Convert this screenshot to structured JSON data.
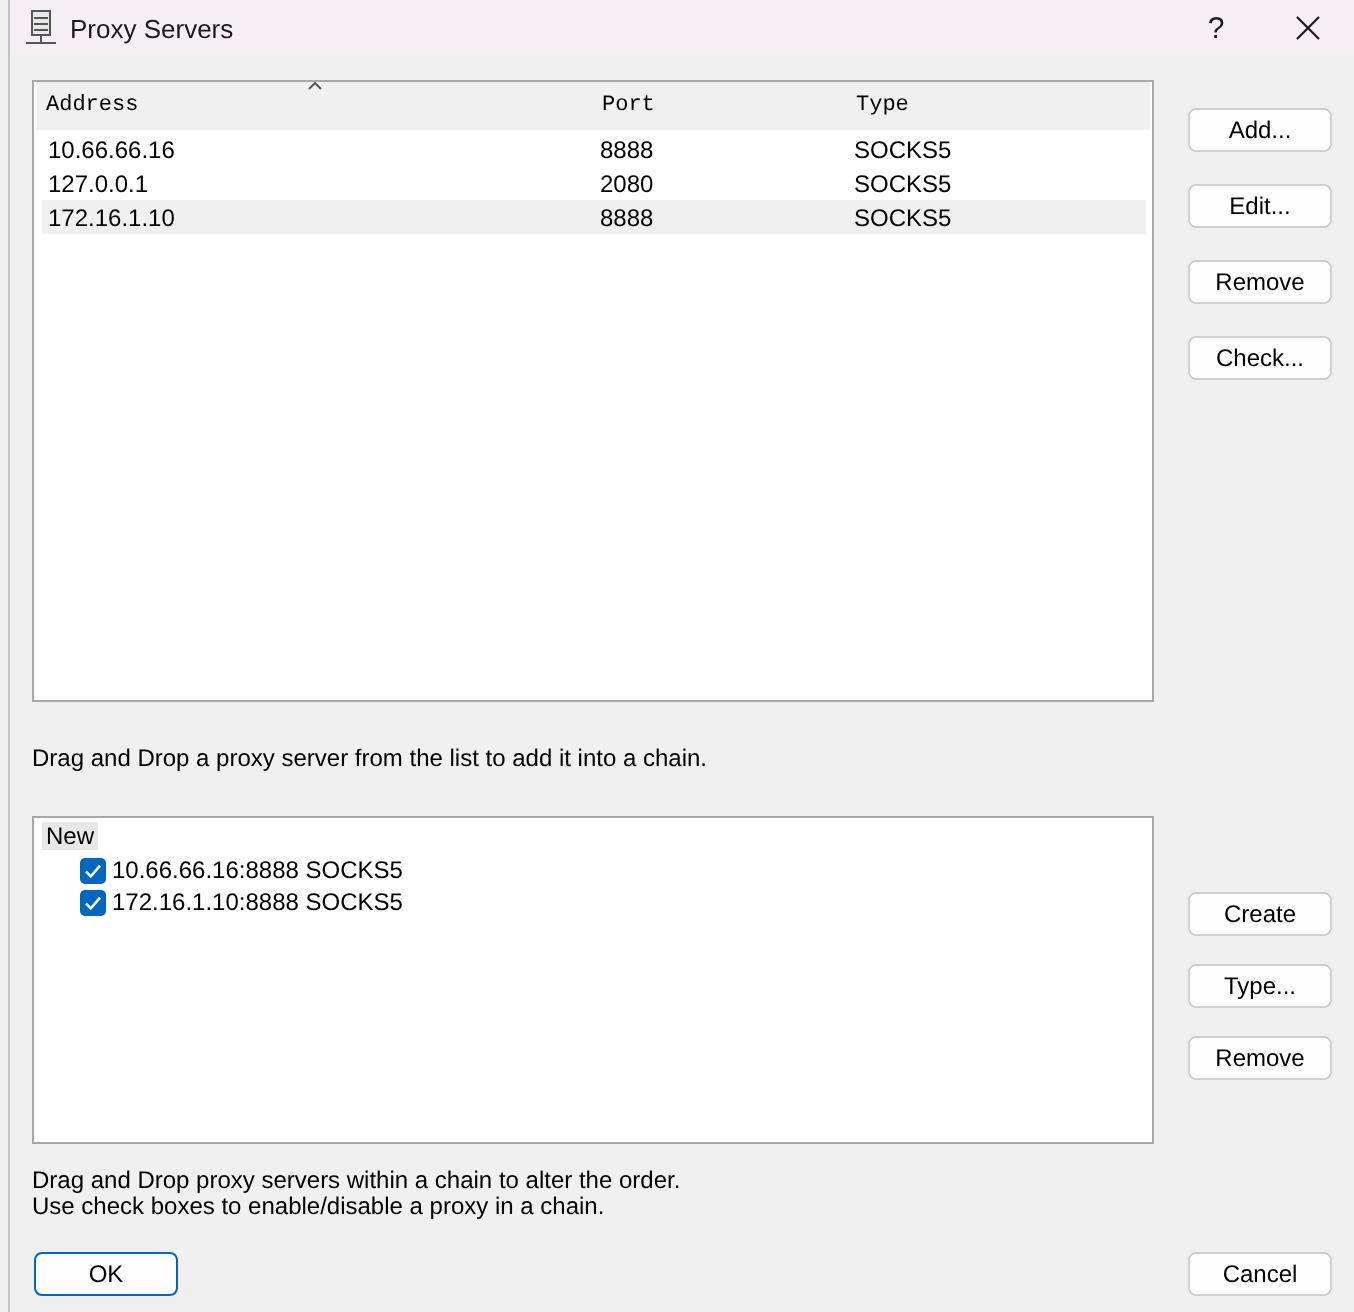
{
  "window": {
    "title": "Proxy Servers",
    "help": "?"
  },
  "proxy_table": {
    "columns": [
      {
        "label": "Address",
        "sorted": true
      },
      {
        "label": "Port",
        "sorted": false
      },
      {
        "label": "Type",
        "sorted": false
      }
    ],
    "rows": [
      {
        "address": "10.66.66.16",
        "port": "8888",
        "type": "SOCKS5",
        "selected": false
      },
      {
        "address": "127.0.0.1",
        "port": "2080",
        "type": "SOCKS5",
        "selected": false
      },
      {
        "address": "172.16.1.10",
        "port": "8888",
        "type": "SOCKS5",
        "selected": true
      }
    ]
  },
  "proxy_buttons": [
    "Add...",
    "Edit...",
    "Remove",
    "Check..."
  ],
  "list_hint": "Drag and Drop a proxy server from the list to add it into a chain.",
  "chains": [
    {
      "name": "New",
      "selected": true,
      "children": [
        {
          "label": "10.66.66.16:8888 SOCKS5",
          "checked": true
        },
        {
          "label": "172.16.1.10:8888 SOCKS5",
          "checked": true
        }
      ]
    }
  ],
  "chain_buttons": [
    "Create",
    "Type...",
    "Remove"
  ],
  "chain_hints": [
    "Drag and Drop proxy servers within a chain to alter the order.",
    "Use check boxes to enable/disable a proxy in a chain."
  ],
  "dialog_buttons": [
    {
      "label": "OK",
      "default": true
    },
    {
      "label": "Cancel",
      "default": false
    }
  ]
}
